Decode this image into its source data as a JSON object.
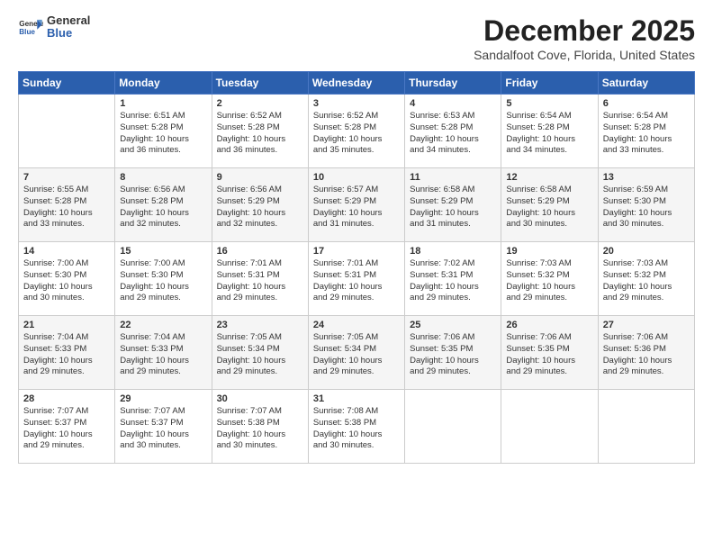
{
  "logo": {
    "general": "General",
    "blue": "Blue"
  },
  "header": {
    "month": "December 2025",
    "location": "Sandalfoot Cove, Florida, United States"
  },
  "weekdays": [
    "Sunday",
    "Monday",
    "Tuesday",
    "Wednesday",
    "Thursday",
    "Friday",
    "Saturday"
  ],
  "weeks": [
    [
      {
        "day": "",
        "content": ""
      },
      {
        "day": "1",
        "content": "Sunrise: 6:51 AM\nSunset: 5:28 PM\nDaylight: 10 hours\nand 36 minutes."
      },
      {
        "day": "2",
        "content": "Sunrise: 6:52 AM\nSunset: 5:28 PM\nDaylight: 10 hours\nand 36 minutes."
      },
      {
        "day": "3",
        "content": "Sunrise: 6:52 AM\nSunset: 5:28 PM\nDaylight: 10 hours\nand 35 minutes."
      },
      {
        "day": "4",
        "content": "Sunrise: 6:53 AM\nSunset: 5:28 PM\nDaylight: 10 hours\nand 34 minutes."
      },
      {
        "day": "5",
        "content": "Sunrise: 6:54 AM\nSunset: 5:28 PM\nDaylight: 10 hours\nand 34 minutes."
      },
      {
        "day": "6",
        "content": "Sunrise: 6:54 AM\nSunset: 5:28 PM\nDaylight: 10 hours\nand 33 minutes."
      }
    ],
    [
      {
        "day": "7",
        "content": "Sunrise: 6:55 AM\nSunset: 5:28 PM\nDaylight: 10 hours\nand 33 minutes."
      },
      {
        "day": "8",
        "content": "Sunrise: 6:56 AM\nSunset: 5:28 PM\nDaylight: 10 hours\nand 32 minutes."
      },
      {
        "day": "9",
        "content": "Sunrise: 6:56 AM\nSunset: 5:29 PM\nDaylight: 10 hours\nand 32 minutes."
      },
      {
        "day": "10",
        "content": "Sunrise: 6:57 AM\nSunset: 5:29 PM\nDaylight: 10 hours\nand 31 minutes."
      },
      {
        "day": "11",
        "content": "Sunrise: 6:58 AM\nSunset: 5:29 PM\nDaylight: 10 hours\nand 31 minutes."
      },
      {
        "day": "12",
        "content": "Sunrise: 6:58 AM\nSunset: 5:29 PM\nDaylight: 10 hours\nand 30 minutes."
      },
      {
        "day": "13",
        "content": "Sunrise: 6:59 AM\nSunset: 5:30 PM\nDaylight: 10 hours\nand 30 minutes."
      }
    ],
    [
      {
        "day": "14",
        "content": "Sunrise: 7:00 AM\nSunset: 5:30 PM\nDaylight: 10 hours\nand 30 minutes."
      },
      {
        "day": "15",
        "content": "Sunrise: 7:00 AM\nSunset: 5:30 PM\nDaylight: 10 hours\nand 29 minutes."
      },
      {
        "day": "16",
        "content": "Sunrise: 7:01 AM\nSunset: 5:31 PM\nDaylight: 10 hours\nand 29 minutes."
      },
      {
        "day": "17",
        "content": "Sunrise: 7:01 AM\nSunset: 5:31 PM\nDaylight: 10 hours\nand 29 minutes."
      },
      {
        "day": "18",
        "content": "Sunrise: 7:02 AM\nSunset: 5:31 PM\nDaylight: 10 hours\nand 29 minutes."
      },
      {
        "day": "19",
        "content": "Sunrise: 7:03 AM\nSunset: 5:32 PM\nDaylight: 10 hours\nand 29 minutes."
      },
      {
        "day": "20",
        "content": "Sunrise: 7:03 AM\nSunset: 5:32 PM\nDaylight: 10 hours\nand 29 minutes."
      }
    ],
    [
      {
        "day": "21",
        "content": "Sunrise: 7:04 AM\nSunset: 5:33 PM\nDaylight: 10 hours\nand 29 minutes."
      },
      {
        "day": "22",
        "content": "Sunrise: 7:04 AM\nSunset: 5:33 PM\nDaylight: 10 hours\nand 29 minutes."
      },
      {
        "day": "23",
        "content": "Sunrise: 7:05 AM\nSunset: 5:34 PM\nDaylight: 10 hours\nand 29 minutes."
      },
      {
        "day": "24",
        "content": "Sunrise: 7:05 AM\nSunset: 5:34 PM\nDaylight: 10 hours\nand 29 minutes."
      },
      {
        "day": "25",
        "content": "Sunrise: 7:06 AM\nSunset: 5:35 PM\nDaylight: 10 hours\nand 29 minutes."
      },
      {
        "day": "26",
        "content": "Sunrise: 7:06 AM\nSunset: 5:35 PM\nDaylight: 10 hours\nand 29 minutes."
      },
      {
        "day": "27",
        "content": "Sunrise: 7:06 AM\nSunset: 5:36 PM\nDaylight: 10 hours\nand 29 minutes."
      }
    ],
    [
      {
        "day": "28",
        "content": "Sunrise: 7:07 AM\nSunset: 5:37 PM\nDaylight: 10 hours\nand 29 minutes."
      },
      {
        "day": "29",
        "content": "Sunrise: 7:07 AM\nSunset: 5:37 PM\nDaylight: 10 hours\nand 30 minutes."
      },
      {
        "day": "30",
        "content": "Sunrise: 7:07 AM\nSunset: 5:38 PM\nDaylight: 10 hours\nand 30 minutes."
      },
      {
        "day": "31",
        "content": "Sunrise: 7:08 AM\nSunset: 5:38 PM\nDaylight: 10 hours\nand 30 minutes."
      },
      {
        "day": "",
        "content": ""
      },
      {
        "day": "",
        "content": ""
      },
      {
        "day": "",
        "content": ""
      }
    ]
  ]
}
